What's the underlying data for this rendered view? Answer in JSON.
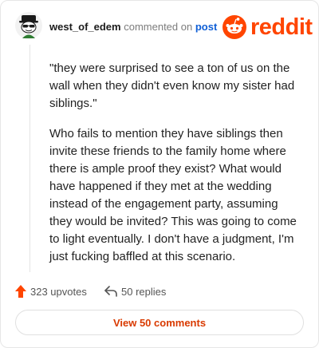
{
  "comment": {
    "username": "west_of_edem",
    "action_text": "commented on",
    "post_link": "post",
    "paragraphs": [
      "\"they were surprised to see a ton of us on the wall when they didn't even know my sister had siblings.\"",
      "Who fails to mention they have siblings then invite these friends to the family home where there is ample proof they exist? What would have happened if they met at the wedding instead of the engagement party, assuming they would be invited? This was going to come to light eventually. I don't have a judgment, I'm just fucking baffled at this scenario."
    ]
  },
  "brand": {
    "name": "reddit",
    "color": "#ff4500"
  },
  "footer": {
    "upvotes": "323 upvotes",
    "replies": "50 replies",
    "view_button": "View 50 comments"
  },
  "colors": {
    "accent": "#d93a00",
    "upvote": "#ff4500",
    "link": "#0f5fd6"
  },
  "icons": {
    "avatar": "snoo-avatar-icon",
    "logo": "reddit-logo-icon",
    "upvote": "upvote-arrow-icon",
    "reply": "reply-arrow-icon"
  }
}
